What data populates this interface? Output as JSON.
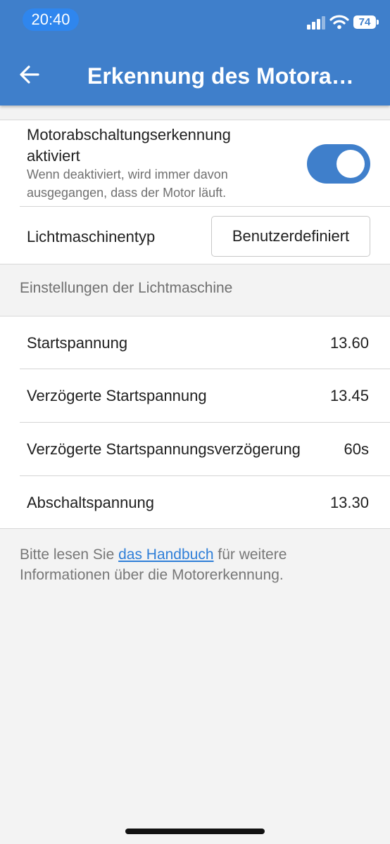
{
  "status_bar": {
    "time": "20:40",
    "battery": "74"
  },
  "header": {
    "title": "Erkennung des Motora…"
  },
  "engine_detection": {
    "title": "Motorabschaltungserkennung aktiviert",
    "subtitle": "Wenn deaktiviert, wird immer davon ausgegangen, dass der Motor läuft.",
    "enabled": true
  },
  "alternator_type": {
    "label": "Lichtmaschinentyp",
    "value": "Benutzerdefiniert"
  },
  "section": {
    "title": "Einstellungen der Lichtmaschine"
  },
  "settings": [
    {
      "label": "Startspannung",
      "value": "13.60"
    },
    {
      "label": "Verzögerte Startspannung",
      "value": "13.45"
    },
    {
      "label": "Verzögerte Startspannungsverzögerung",
      "value": "60s"
    },
    {
      "label": "Abschaltspannung",
      "value": "13.30"
    }
  ],
  "footer": {
    "prefix": "Bitte lesen Sie ",
    "link": "das Handbuch",
    "suffix": " für weitere Informationen über die Motorerkennung."
  },
  "colors": {
    "accent": "#3f7fcb",
    "link": "#2f7fd8",
    "time_pill": "#2f86ee"
  },
  "icons": {
    "back": "back-arrow-icon",
    "signal": "cellular-signal-icon",
    "wifi": "wifi-icon",
    "battery": "battery-icon"
  }
}
